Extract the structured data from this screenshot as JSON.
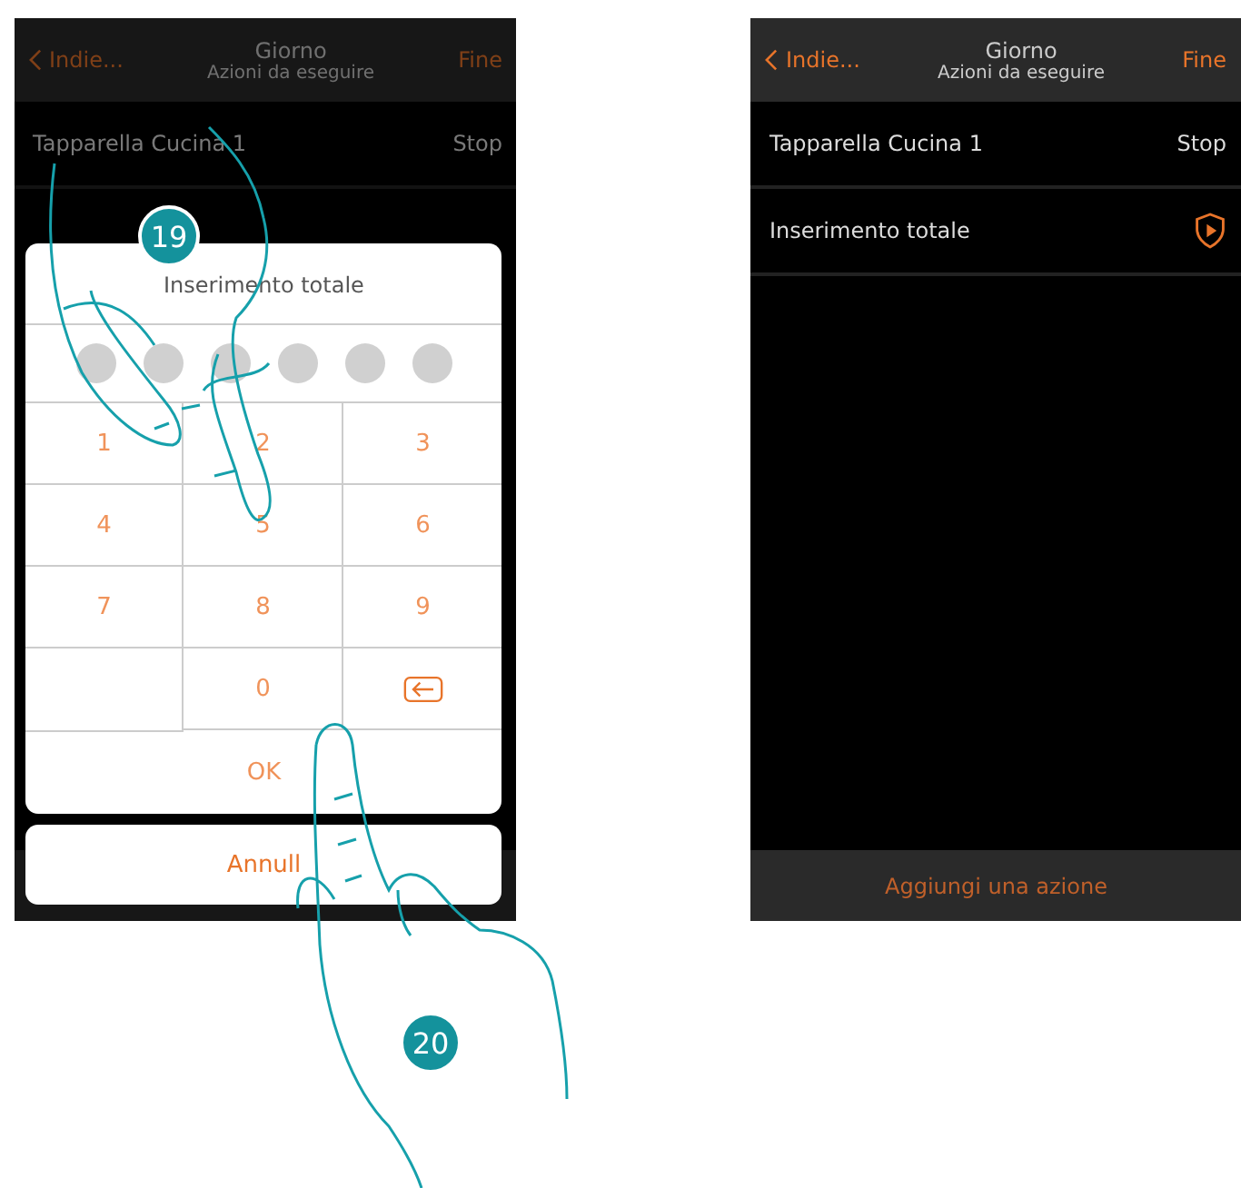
{
  "screens": [
    {
      "header": {
        "back": "Indie...",
        "title": "Giorno",
        "subtitle": "Azioni da eseguire",
        "done": "Fine"
      },
      "rows": [
        {
          "label": "Tapparella Cucina 1",
          "kind": "text",
          "value": "Stop"
        }
      ],
      "dimmed": true,
      "dialog": {
        "title": "Inserimento totale",
        "pin": [
          {
            "filled": false
          },
          {
            "filled": false
          },
          {
            "filled": false
          },
          {
            "filled": false
          },
          {
            "filled": false
          },
          {
            "filled": false
          }
        ],
        "keys": [
          {
            "kind": "digit",
            "label": "1"
          },
          {
            "kind": "digit",
            "label": "2"
          },
          {
            "kind": "digit",
            "label": "3"
          },
          {
            "kind": "digit",
            "label": "4"
          },
          {
            "kind": "digit",
            "label": "5"
          },
          {
            "kind": "digit",
            "label": "6"
          },
          {
            "kind": "digit",
            "label": "7"
          },
          {
            "kind": "digit",
            "label": "8"
          },
          {
            "kind": "digit",
            "label": "9"
          },
          {
            "kind": "blank"
          },
          {
            "kind": "digit",
            "label": "0"
          },
          {
            "kind": "backspace"
          }
        ],
        "ok": "OK",
        "cancel": "Annull"
      }
    },
    {
      "header": {
        "back": "Indie...",
        "title": "Giorno",
        "subtitle": "Azioni da eseguire",
        "done": "Fine"
      },
      "rows": [
        {
          "label": "Tapparella Cucina 1",
          "kind": "text",
          "value": "Stop"
        },
        {
          "label": "Inserimento totale",
          "kind": "alarm"
        }
      ],
      "dimmed": false,
      "footer": "Aggiungi una azione"
    }
  ],
  "steps": [
    "19",
    "20"
  ]
}
